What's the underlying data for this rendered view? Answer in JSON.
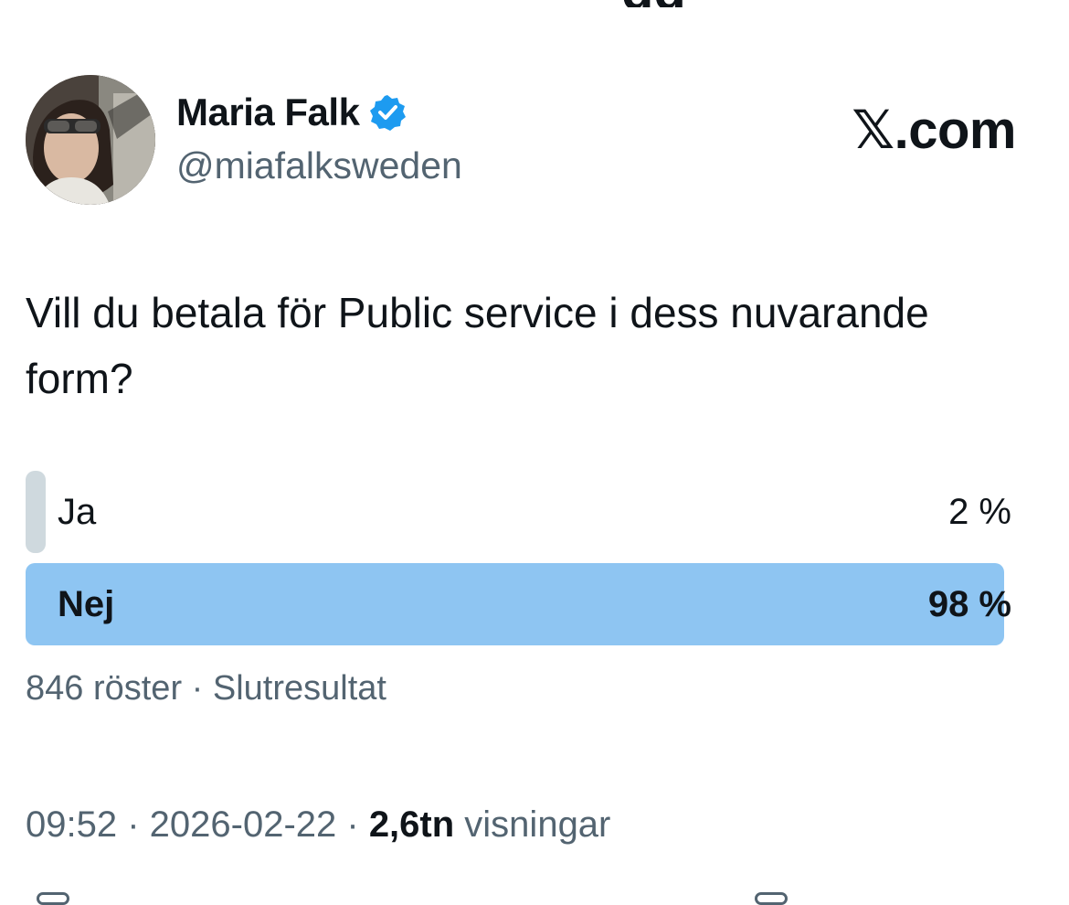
{
  "top_partial_text": "gg",
  "author": {
    "name": "Maria Falk",
    "handle": "@miafalksweden",
    "verified_icon": "verified-badge-icon",
    "avatar": "avatar"
  },
  "brand": {
    "glyph": "𝕏",
    "suffix": ".com"
  },
  "tweet": {
    "text": "Vill du betala för Public service i dess nuvarande form?"
  },
  "poll": {
    "options": [
      {
        "label": "Ja",
        "percent_text": "2 %",
        "percent": 2,
        "winner": false
      },
      {
        "label": "Nej",
        "percent_text": "98 %",
        "percent": 98,
        "winner": true
      }
    ],
    "votes": "846 röster",
    "separator": " · ",
    "status": "Slutresultat"
  },
  "meta": {
    "time": "09:52",
    "date": "2026-02-22",
    "views_count": "2,6tn",
    "views_label": "visningar",
    "separator": " · "
  },
  "colors": {
    "accent": "#1d9bf0",
    "poll_winner_bar": "#8ec5f2",
    "poll_loser_bar": "#cfd9de",
    "secondary_text": "#536471",
    "primary_text": "#0f1419"
  }
}
